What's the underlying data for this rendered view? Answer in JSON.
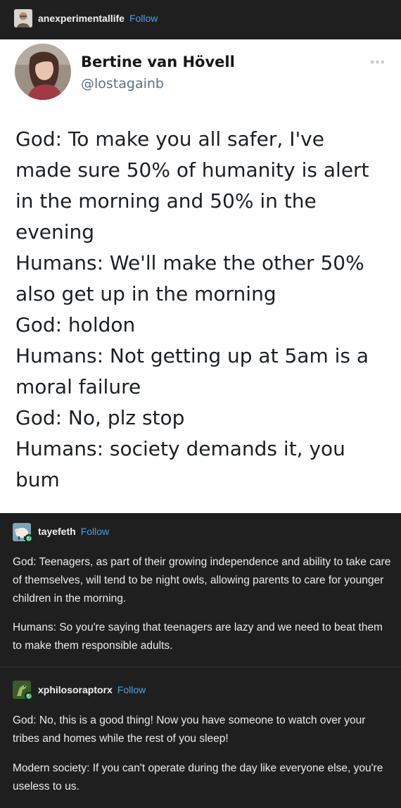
{
  "header": {
    "username": "anexperimentallife",
    "follow_label": "Follow"
  },
  "tweet": {
    "name": "Bertine van Hövell",
    "handle": "@lostagainb",
    "more_icon": "ellipsis-icon",
    "lines": [
      "God: To make you all safer, I've",
      "made sure 50% of humanity is alert",
      "in the morning and 50% in the",
      "evening",
      "Humans: We'll make the other 50%",
      "also get up in the morning",
      "God: holdon",
      "Humans: Not getting up at 5am is a",
      "moral failure",
      "God: No, plz stop",
      "Humans: society demands it, you",
      "bum"
    ]
  },
  "replies": [
    {
      "username": "tayefeth",
      "follow_label": "Follow",
      "paragraphs": [
        "God: Teenagers, as part of their growing independence and ability to take care of themselves, will tend to be night owls, allowing parents to care for younger children in the morning.",
        "Humans: So you're saying that teenagers are lazy and we need to beat them to make them responsible adults."
      ]
    },
    {
      "username": "xphilosoraptorx",
      "follow_label": "Follow",
      "paragraphs": [
        "God: No, this is a good thing! Now you have someone to watch over your tribes and homes while the rest of you sleep!",
        "Modern society: If you can't operate during the day like everyone else, you're useless to us."
      ]
    }
  ],
  "colors": {
    "background": "#1f1f1f",
    "link": "#4d9fe8",
    "tweet_bg": "#ffffff",
    "badge": "#2fb45a"
  }
}
